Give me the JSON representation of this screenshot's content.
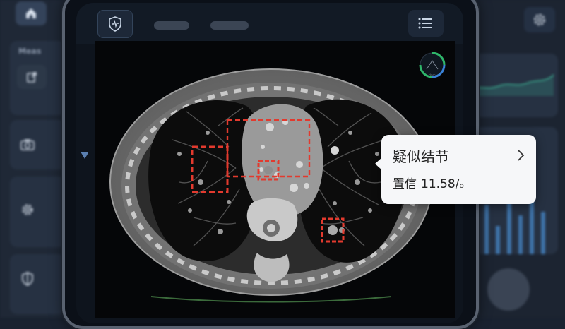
{
  "background": {
    "left_card_label": "Meas"
  },
  "popup": {
    "title": "疑似结节",
    "confidence_label": "置信",
    "confidence_value": "11.58/ₒ"
  },
  "scan": {
    "gauge_label": "dash"
  },
  "colors": {
    "accent_red": "#e23a2e",
    "popup_bg": "#f6f7f9",
    "app_dark": "#0e141d",
    "gauge_green": "#2fb56a",
    "gauge_blue": "#3a82d8"
  },
  "icons": [
    "home-icon",
    "export-icon",
    "camera-icon",
    "gear-icon",
    "shield-icon",
    "shield-heart-icon",
    "menu-icon",
    "chevron-right-icon"
  ]
}
